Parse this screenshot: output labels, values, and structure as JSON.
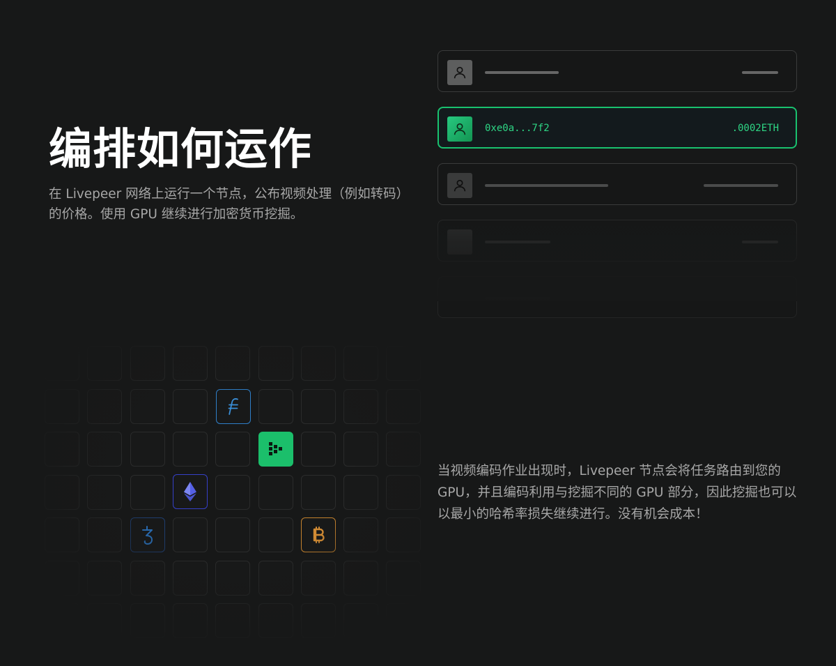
{
  "heading": {
    "title": "编排如何运作",
    "subtitle": "在 Livepeer 网络上运行一个节点，公布视频处理（例如转码）的价格。使用 GPU 继续进行加密货币挖掘。"
  },
  "description": "当视频编码作业出现时，Livepeer 节点会将任务路由到您的 GPU，并且编码利用与挖掘不同的 GPU 部分，因此挖掘也可以以最小的哈希率损失继续进行。没有机会成本！",
  "node_list": {
    "active_node": {
      "address": "0xe0a...7f2",
      "amount": ".0002ETH"
    }
  },
  "token_grid": {
    "tokens": [
      "filecoin-icon",
      "livepeer-icon",
      "ethereum-icon",
      "tezos-icon",
      "bitcoin-icon"
    ]
  },
  "colors": {
    "background": "#171818",
    "accent_green": "#19c26f",
    "filecoin": "#2f7fc9",
    "ethereum": "#3640c8",
    "tezos": "#2a5d9f",
    "bitcoin": "#c5822e"
  }
}
